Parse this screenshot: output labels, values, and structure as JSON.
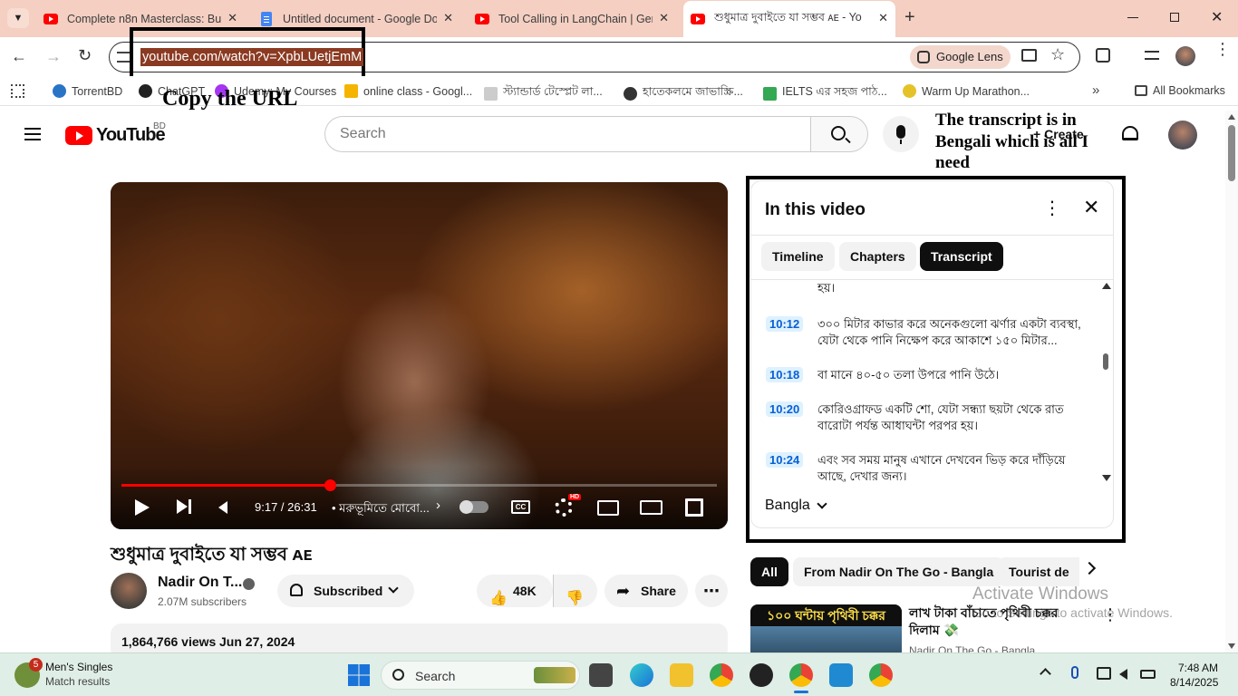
{
  "browser": {
    "tabs": [
      {
        "title": "Complete n8n Masterclass: Buil",
        "favicon": "youtube-icon"
      },
      {
        "title": "Untitled document - Google Do",
        "favicon": "google-docs-icon"
      },
      {
        "title": "Tool Calling in LangChain | Gen",
        "favicon": "youtube-icon"
      },
      {
        "title": "শুধুমাত্র দুবাইতে যা সম্ভব ᴀᴇ - Yo",
        "favicon": "youtube-icon",
        "active": true
      }
    ],
    "url": "youtube.com/watch?v=XpbLUetjEmM",
    "google_lens_label": "Google Lens",
    "bookmarks": [
      "TorrentBD",
      "ChatGPT",
      "Udemy: My Courses",
      "online class - Googl...",
      "স্ট্যান্ডার্ড টেস্প্লেট লা...",
      "হাতেকলমে জাভাস্ক্রি...",
      "IELTS এর সহজ পাঠ...",
      "Warm Up Marathon..."
    ],
    "all_bookmarks_label": "All Bookmarks"
  },
  "annotations": {
    "copy_url": "Copy the URL",
    "transcript_note": "The transcript is in Bengali which is all I need"
  },
  "youtube": {
    "logo_text": "YouTube",
    "country_code": "BD",
    "search_placeholder": "Search",
    "create_label": "Create"
  },
  "player": {
    "time": "9:17 / 26:31",
    "chapter": "• মরুভূমিতে মোবো...",
    "progress_fraction": 0.35,
    "hd_badge": "HD",
    "cc_label": "CC"
  },
  "panel": {
    "title": "In this video",
    "tabs": [
      "Timeline",
      "Chapters",
      "Transcript"
    ],
    "selected_tab": "Transcript",
    "first_fragment": "হয়।",
    "segments": [
      {
        "time": "10:12",
        "text": "৩০০ মিটার কাভার করে অনেকগুলো ঝর্ণার একটা ব্যবস্থা, যেটা থেকে পানি নিক্ষেপ করে আকাশে ১৫০ মিটার..."
      },
      {
        "time": "10:18",
        "text": "বা মানে ৪০-৫০ তলা উপরে পানি উঠে।"
      },
      {
        "time": "10:20",
        "text": "কোরিওগ্রাফড একটি শো, যেটা সন্ধ্যা ছয়টা থেকে রাত বারোটা পর্যন্ত আধাঘন্টা পরপর হয়।"
      },
      {
        "time": "10:24",
        "text": "এবং সব সময় মানুষ এখানে দেখবেন ভিড় করে দাঁড়িয়ে আছে, দেখার জন্য।"
      }
    ],
    "language": "Bangla"
  },
  "video": {
    "title": "শুধুমাত্র দুবাইতে যা সম্ভব ᴀᴇ",
    "channel": "Nadir On T...",
    "subscribers": "2.07M subscribers",
    "subscribed_label": "Subscribed",
    "likes": "48K",
    "share_label": "Share",
    "views": "1,864,766 views",
    "date": "Jun 27, 2024"
  },
  "recommendations": {
    "chips": [
      "All",
      "From Nadir On The Go - Bangla",
      "Tourist de"
    ],
    "first_item": {
      "thumbnail_text": "১০০ ঘন্টায় পৃথিবী চক্কর",
      "title": "লাখ টাকা বাঁচাতে পৃথিবী চক্কর দিলাম 💸",
      "channel": "Nadir On The Go - Bangla"
    }
  },
  "watermark": {
    "line1": "Activate Windows",
    "line2": "Go to Settings to activate Windows."
  },
  "taskbar": {
    "notification_count": "5",
    "widget_title": "Men's Singles",
    "widget_subtitle": "Match results",
    "search_label": "Search",
    "time": "7:48 AM",
    "date": "8/14/2025"
  }
}
